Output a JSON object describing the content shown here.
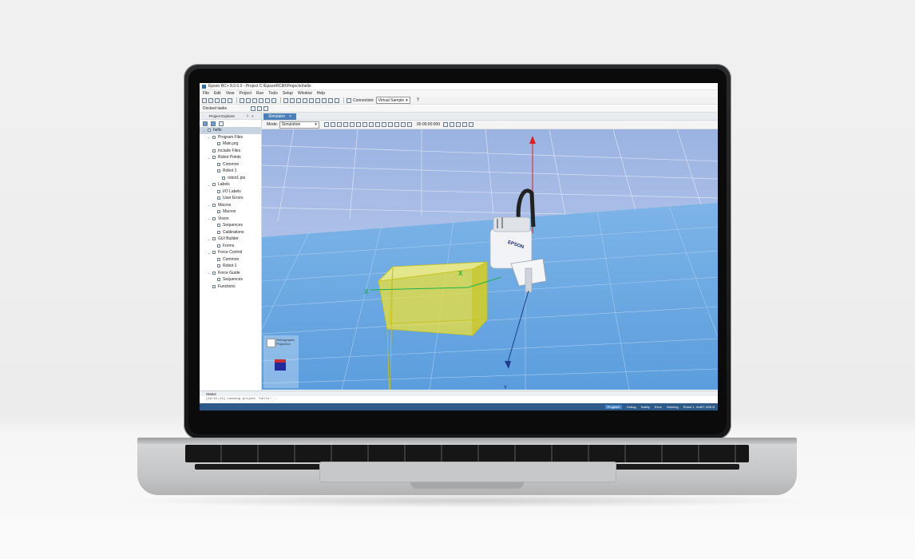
{
  "window": {
    "title": "Epson RC+ 8.0.0.0 - Project C:\\EpsonRC80\\Projects\\hello"
  },
  "menu": [
    "File",
    "Edit",
    "View",
    "Project",
    "Run",
    "Tools",
    "Setup",
    "Window",
    "Help"
  ],
  "toolbar": {
    "connection_label": "Connection:",
    "connection_value": "Virtual Sample"
  },
  "docked_label": "Docked tasks",
  "explorer": {
    "header": "Project Explorer",
    "tree": [
      {
        "label": "hello",
        "depth": 0,
        "icon": "folder-icon",
        "selected": true
      },
      {
        "label": "Program Files",
        "depth": 1,
        "icon": "folder-icon"
      },
      {
        "label": "Main.prg",
        "depth": 2,
        "icon": "file-icon"
      },
      {
        "label": "Include Files",
        "depth": 1,
        "icon": "folder-icon"
      },
      {
        "label": "Robot Points",
        "depth": 1,
        "icon": "points-icon"
      },
      {
        "label": "Common",
        "depth": 2,
        "icon": "points-icon"
      },
      {
        "label": "Robot 1",
        "depth": 2,
        "icon": "points-icon"
      },
      {
        "label": "robot1.pts",
        "depth": 3,
        "icon": "file-icon"
      },
      {
        "label": "Labels",
        "depth": 1,
        "icon": "label-icon"
      },
      {
        "label": "I/O Labels",
        "depth": 2,
        "icon": "label-icon"
      },
      {
        "label": "User Errors",
        "depth": 2,
        "icon": "label-icon"
      },
      {
        "label": "Macros",
        "depth": 1,
        "icon": "macro-icon"
      },
      {
        "label": "Macros",
        "depth": 2,
        "icon": "macro-icon"
      },
      {
        "label": "Vision",
        "depth": 1,
        "icon": "camera-icon"
      },
      {
        "label": "Sequences",
        "depth": 2,
        "icon": "sequence-icon"
      },
      {
        "label": "Calibrations",
        "depth": 2,
        "icon": "calibration-icon"
      },
      {
        "label": "GUI Builder",
        "depth": 1,
        "icon": "form-icon"
      },
      {
        "label": "Forms",
        "depth": 2,
        "icon": "form-icon"
      },
      {
        "label": "Force Control",
        "depth": 1,
        "icon": "force-icon"
      },
      {
        "label": "Common",
        "depth": 2,
        "icon": "force-icon"
      },
      {
        "label": "Robot 1",
        "depth": 2,
        "icon": "force-icon"
      },
      {
        "label": "Force Guide",
        "depth": 1,
        "icon": "force-icon"
      },
      {
        "label": "Sequences",
        "depth": 2,
        "icon": "sequence-icon"
      },
      {
        "label": "Functions",
        "depth": 1,
        "icon": "function-icon"
      }
    ]
  },
  "document": {
    "tab_label": "Simulator",
    "mode_label": "Mode:",
    "mode_value": "Simulation",
    "time": "00:00:00:000"
  },
  "viewport": {
    "projection_text_1": "Orthographic",
    "projection_text_2": "Projection",
    "axis_x": "X",
    "axis_y": "Y",
    "brand": "EPSON",
    "colors": {
      "sky": "#b4c6ea",
      "floor": "#6ea8e3",
      "box": "#f5eb2e",
      "z_axis": "#e02020",
      "x_axis": "#19b34a",
      "y_axis": "#1f3a8c"
    }
  },
  "status": {
    "header": "Status",
    "line": "[16:51:23] Loading project 'hello'..."
  },
  "statusbar": [
    "Program",
    "Debug",
    "Safety",
    "Error",
    "Warning",
    "Robot 1, rbd6T, 6S6 B"
  ]
}
